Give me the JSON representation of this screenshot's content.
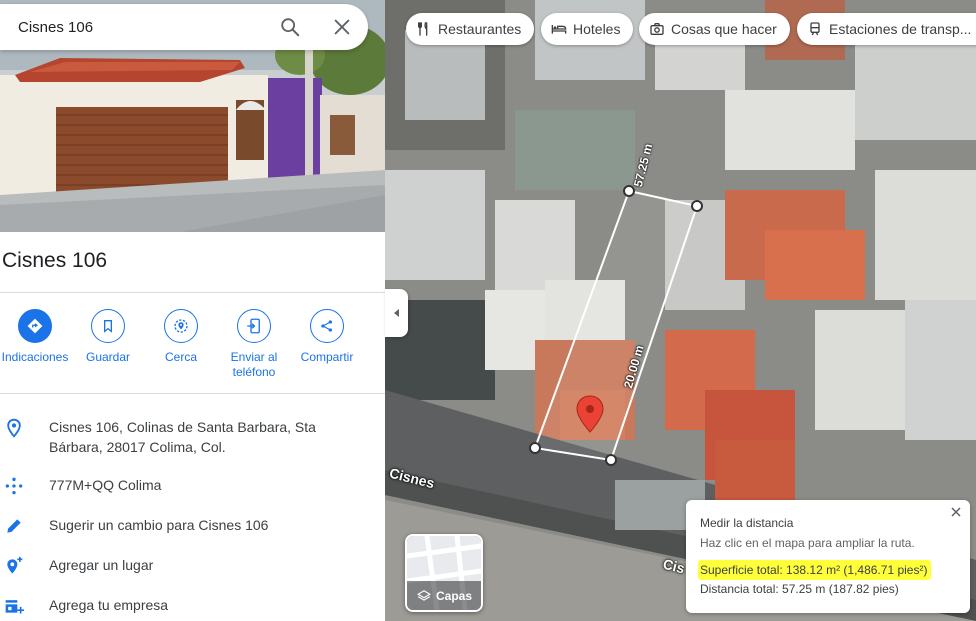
{
  "search": {
    "value": "Cisnes 106"
  },
  "place": {
    "title": "Cisnes 106"
  },
  "actions": [
    {
      "label": "Indicaciones"
    },
    {
      "label": "Guardar"
    },
    {
      "label": "Cerca"
    },
    {
      "label": "Enviar al teléfono"
    },
    {
      "label": "Compartir"
    }
  ],
  "info": {
    "address": "Cisnes 106, Colinas de Santa Barbara, Sta Bárbara, 28017 Colima, Col.",
    "plus_code": "777M+QQ Colima",
    "suggest_edit": "Sugerir un cambio para Cisnes 106",
    "add_place": "Agregar un lugar",
    "add_business": "Agrega tu empresa"
  },
  "chips": [
    {
      "label": "Restaurantes",
      "icon": "restaurant-icon"
    },
    {
      "label": "Hoteles",
      "icon": "hotel-icon"
    },
    {
      "label": "Cosas que hacer",
      "icon": "camera-icon"
    },
    {
      "label": "Estaciones de transp...",
      "icon": "train-icon"
    }
  ],
  "map": {
    "street_name_1": "Cisnes",
    "street_name_2": "Cis",
    "measure_label_top": "57.25 m",
    "measure_label_side": "20.00 m",
    "layers_label": "Capas"
  },
  "measure_card": {
    "title": "Medir la distancia",
    "hint": "Haz clic en el mapa para ampliar la ruta.",
    "area": "Superficie total: 138.12 m² (1,486.71 pies²)",
    "distance": "Distancia total: 57.25 m (187.82 pies)"
  },
  "colors": {
    "accent": "#1a73e8",
    "highlight": "#ffff3a",
    "pin": "#ea4335"
  }
}
